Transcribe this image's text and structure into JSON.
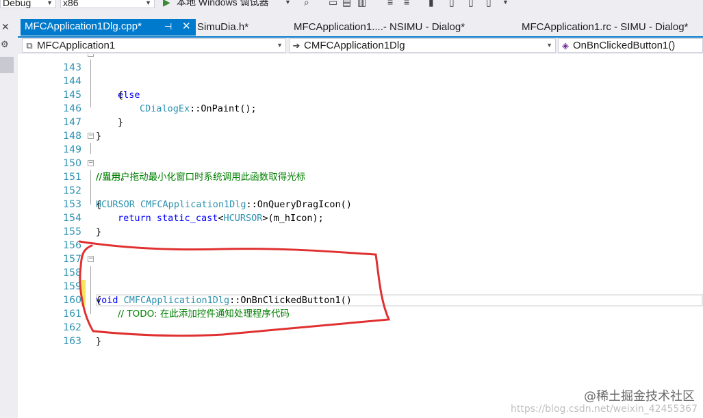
{
  "toolbar": {
    "config": "Debug",
    "platform": "x86",
    "run_label": "本地 Windows 调试器"
  },
  "tabs": [
    {
      "label": "MFCApplication1Dlg.cpp*",
      "active": true
    },
    {
      "label": "SimuDia.h*"
    },
    {
      "label": "MFCApplication1....- NSIMU - Dialog*"
    },
    {
      "label": "MFCApplication1.rc - SIMU - Dialog*"
    }
  ],
  "nav": {
    "project": "MFCApplication1",
    "class": "CMFCApplication1Dlg",
    "member": "OnBnClickedButton1()"
  },
  "code": {
    "l143": "else",
    "l144": "{",
    "l145_type": "CDialogEx",
    "l145_rest": "::OnPaint();",
    "l146": "}",
    "l147": "}",
    "l149": "//当用户拖动最小化窗口时系统调用此函数取得光标",
    "l150": "//显示。",
    "l151_type1": "HCURSOR",
    "l151_type2": "CMFCApplication1Dlg",
    "l151_rest": "::OnQueryDragIcon()",
    "l152": "{",
    "l153_kw": "return",
    "l153_kw2": "static_cast",
    "l153_lt": "<",
    "l153_type": "HCURSOR",
    "l153_rest": ">(m_hIcon);",
    "l154": "}",
    "l158_kw": "void",
    "l158_type": "CMFCApplication1Dlg",
    "l158_rest": "::OnBnClickedButton1()",
    "l159": "{",
    "l160": "// TODO: 在此添加控件通知处理程序代码",
    "l162": "}"
  },
  "line_numbers": [
    "143",
    "144",
    "145",
    "146",
    "147",
    "148",
    "149",
    "150",
    "151",
    "152",
    "153",
    "154",
    "155",
    "156",
    "157",
    "158",
    "159",
    "160",
    "161",
    "162",
    "163"
  ],
  "watermark": "@稀土掘金技术社区",
  "watermark_url": "https://blog.csdn.net/weixin_42455367",
  "accent": "#007acc",
  "annotation_color": "#e03030"
}
